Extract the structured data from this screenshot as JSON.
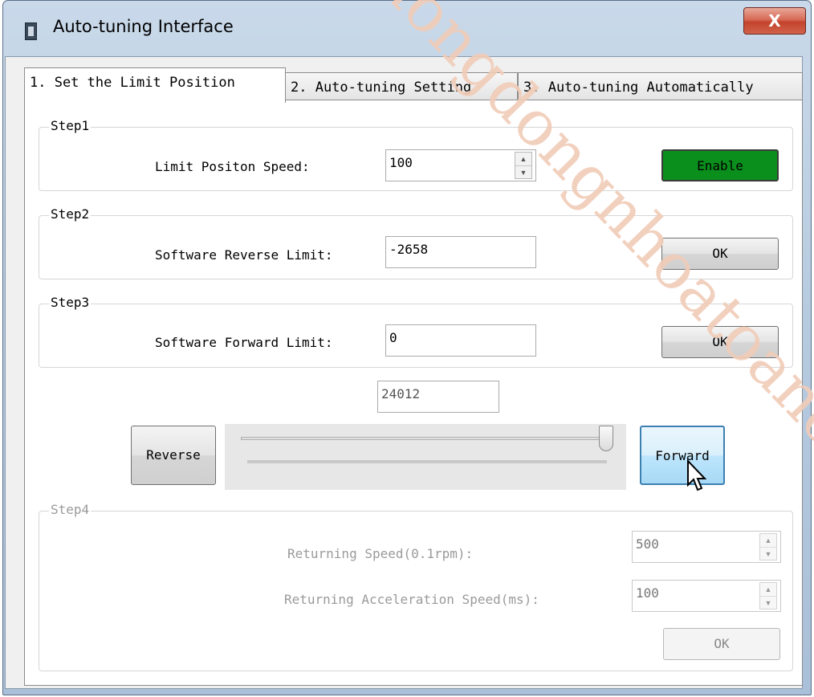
{
  "window": {
    "title": "Auto-tuning Interface",
    "close_label": "X"
  },
  "tabs": [
    {
      "label": "1. Set the Limit Position",
      "active": true
    },
    {
      "label": "2. Auto-tuning Setting",
      "active": false
    },
    {
      "label": "3. Auto-tuning Automatically",
      "active": false
    }
  ],
  "step1": {
    "legend": "Step1",
    "label": "Limit Positon Speed:",
    "value": "100",
    "button": "Enable",
    "button_color": "#0b8f1c"
  },
  "step2": {
    "legend": "Step2",
    "label": "Software Reverse Limit:",
    "value": "-2658",
    "button": "OK"
  },
  "step3": {
    "legend": "Step3",
    "label": "Software Forward Limit:",
    "value": "0",
    "button": "OK"
  },
  "jog": {
    "position_value": "24012",
    "reverse_label": "Reverse",
    "forward_label": "Forward",
    "slider_level": 1.0
  },
  "step4": {
    "legend": "Step4",
    "returning_speed_label": "Returning Speed(0.1rpm):",
    "returning_speed_value": "500",
    "returning_accel_label": "Returning Acceleration Speed(ms):",
    "returning_accel_value": "100",
    "button": "OK",
    "disabled": true
  },
  "watermark": {
    "text": "dongdongnhoatoanca",
    "color": "#f1ccb8"
  }
}
